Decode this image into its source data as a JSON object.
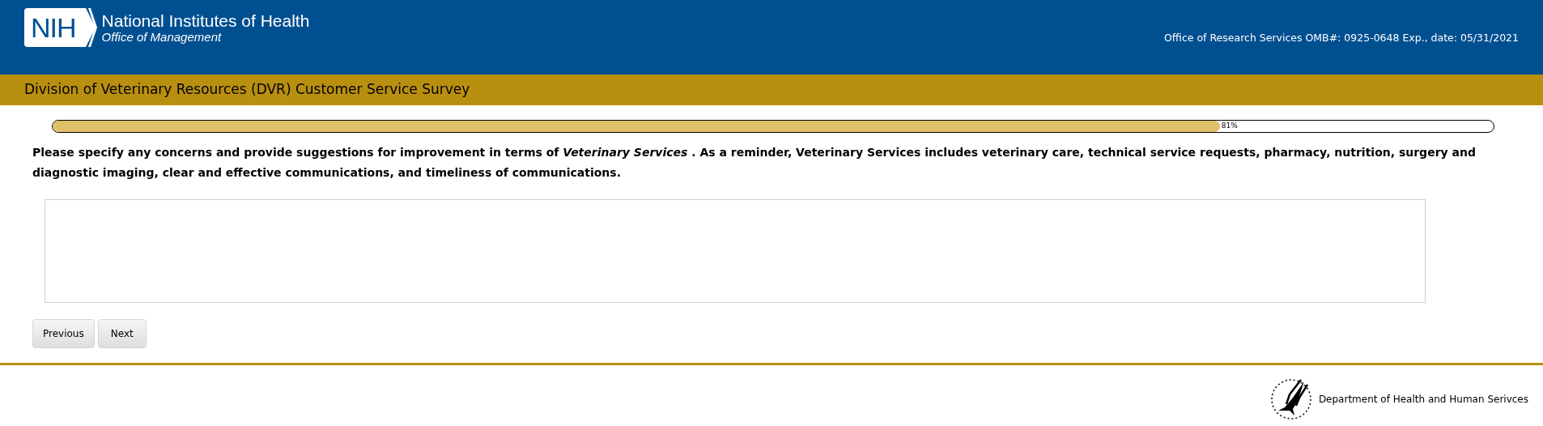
{
  "header": {
    "logo_mark": "NIH",
    "title": "National Institutes of Health",
    "subtitle": "Office of Management",
    "omb_notice": "Office of Research Services OMB#: 0925-0648 Exp., date: 05/31/2021"
  },
  "survey_title": "Division of Veterinary Resources (DVR) Customer Service Survey",
  "progress": {
    "level": 0.81,
    "reading": "81%"
  },
  "question": "Please specify any concerns and provide suggestions for improvement in terms of *Veterinary Services* . As a reminder, Veterinary Services includes veterinary care, technical service requests, pharmacy, nutrition, surgery and diagnostic imaging, clear and effective communications, and timeliness of communications.",
  "buttons": [
    "Previous",
    "Next"
  ],
  "footer": {
    "department": "Department of Health and Human Serivces"
  }
}
